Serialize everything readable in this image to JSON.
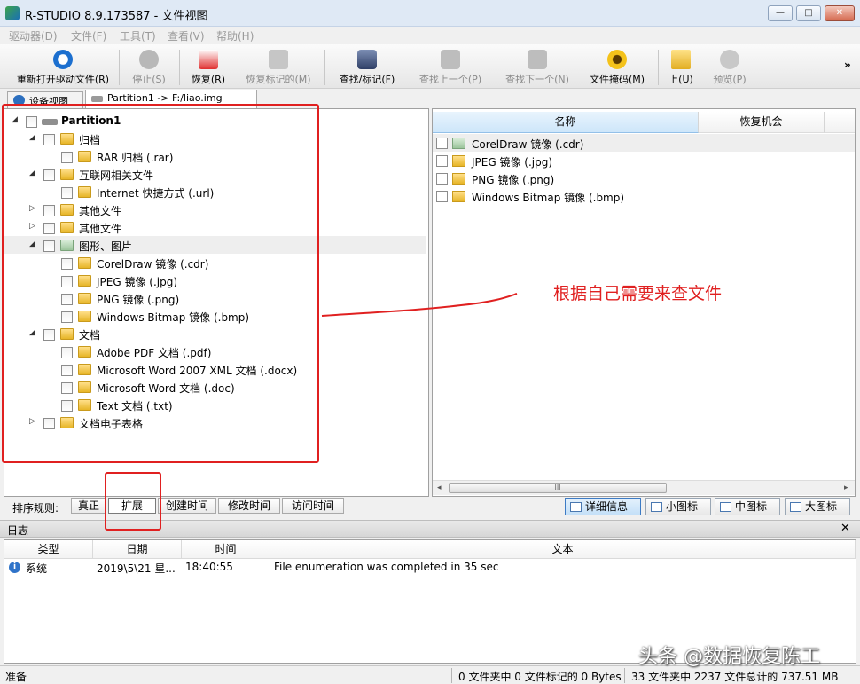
{
  "window": {
    "title": "R-STUDIO 8.9.173587 - 文件视图",
    "minimize": "—",
    "maximize": "□",
    "close": "✕"
  },
  "menu": [
    "驱动器(D)",
    "文件(F)",
    "工具(T)",
    "查看(V)",
    "帮助(H)"
  ],
  "toolbar": {
    "buttons": [
      {
        "label": "重新打开驱动文件(R)",
        "icon": "refresh-icon",
        "enabled": true
      },
      {
        "label": "停止(S)",
        "icon": "stop-icon",
        "enabled": false
      },
      {
        "label": "恢复(R)",
        "icon": "recover-icon",
        "enabled": true
      },
      {
        "label": "恢复标记的(M)",
        "icon": "recover-marked-icon",
        "enabled": false
      },
      {
        "label": "查找/标记(F)",
        "icon": "binoculars-icon",
        "enabled": true
      },
      {
        "label": "查找上一个(P)",
        "icon": "find-prev-icon",
        "enabled": false
      },
      {
        "label": "查找下一个(N)",
        "icon": "find-next-icon",
        "enabled": false
      },
      {
        "label": "文件掩码(M)",
        "icon": "file-mask-icon",
        "enabled": true
      },
      {
        "label": "上(U)",
        "icon": "folder-up-icon",
        "enabled": true
      },
      {
        "label": "预览(P)",
        "icon": "preview-icon",
        "enabled": false
      }
    ],
    "more": "»"
  },
  "tabs": [
    {
      "label": "设备视图",
      "active": false
    },
    {
      "label": "Partition1 -> F:/liao.img",
      "active": true
    }
  ],
  "tree": [
    {
      "label": "Partition1",
      "level": 0,
      "toggle": "◢",
      "kind": "drive"
    },
    {
      "label": "归档",
      "level": 1,
      "toggle": "◢",
      "kind": "folder"
    },
    {
      "label": "RAR 归档 (.rar)",
      "level": 2,
      "toggle": "",
      "kind": "folder"
    },
    {
      "label": "互联网相关文件",
      "level": 1,
      "toggle": "◢",
      "kind": "folder"
    },
    {
      "label": "Internet 快捷方式 (.url)",
      "level": 2,
      "toggle": "",
      "kind": "folder"
    },
    {
      "label": "其他文件",
      "level": 1,
      "toggle": "▷",
      "kind": "folder"
    },
    {
      "label": "其他文件",
      "level": 1,
      "toggle": "▷",
      "kind": "folder"
    },
    {
      "label": "图形、图片",
      "level": 1,
      "toggle": "◢",
      "kind": "folder-green",
      "highlight": true
    },
    {
      "label": "CorelDraw 镜像 (.cdr)",
      "level": 2,
      "toggle": "",
      "kind": "folder"
    },
    {
      "label": "JPEG 镜像 (.jpg)",
      "level": 2,
      "toggle": "",
      "kind": "folder"
    },
    {
      "label": "PNG 镜像 (.png)",
      "level": 2,
      "toggle": "",
      "kind": "folder"
    },
    {
      "label": "Windows Bitmap 镜像 (.bmp)",
      "level": 2,
      "toggle": "",
      "kind": "folder"
    },
    {
      "label": "文档",
      "level": 1,
      "toggle": "◢",
      "kind": "folder"
    },
    {
      "label": "Adobe PDF 文档 (.pdf)",
      "level": 2,
      "toggle": "",
      "kind": "folder"
    },
    {
      "label": "Microsoft Word 2007 XML 文档 (.docx)",
      "level": 2,
      "toggle": "",
      "kind": "folder"
    },
    {
      "label": "Microsoft Word 文档 (.doc)",
      "level": 2,
      "toggle": "",
      "kind": "folder"
    },
    {
      "label": "Text 文档 (.txt)",
      "level": 2,
      "toggle": "",
      "kind": "folder"
    },
    {
      "label": "文档电子表格",
      "level": 1,
      "toggle": "▷",
      "kind": "folder"
    }
  ],
  "list": {
    "columns": [
      "名称",
      "恢复机会",
      ""
    ],
    "rows": [
      {
        "name": "CorelDraw 镜像 (.cdr)",
        "kind": "folder-green",
        "highlight": true
      },
      {
        "name": "JPEG 镜像 (.jpg)",
        "kind": "folder"
      },
      {
        "name": "PNG 镜像 (.png)",
        "kind": "folder"
      },
      {
        "name": "Windows Bitmap 镜像 (.bmp)",
        "kind": "folder"
      }
    ],
    "scroll_left": "◂",
    "scroll_right": "▸",
    "scroll_grip": "III"
  },
  "sortbar": {
    "label": "排序规则:",
    "buttons": [
      "真正",
      "扩展",
      "创建时间",
      "修改时间",
      "访问时间"
    ],
    "pressed": 1,
    "views": [
      "详细信息",
      "小图标",
      "中图标",
      "大图标"
    ],
    "active_view": 0
  },
  "log": {
    "title": "日志",
    "close": "✕",
    "columns": [
      "类型",
      "日期",
      "时间",
      "文本"
    ],
    "rows": [
      {
        "type": "系统",
        "date": "2019\\5\\21 星...",
        "time": "18:40:55",
        "text": "File enumeration was completed in 35 sec"
      }
    ]
  },
  "status": {
    "ready": "准备",
    "marked": "0 文件夹中 0 文件标记的 0 Bytes",
    "total": "33 文件夹中 2237 文件总计的 737.51 MB"
  },
  "annotation": {
    "text": "根据自己需要来查文件",
    "color": "#e02020"
  },
  "watermark": "头条 @数据恢复陈工"
}
